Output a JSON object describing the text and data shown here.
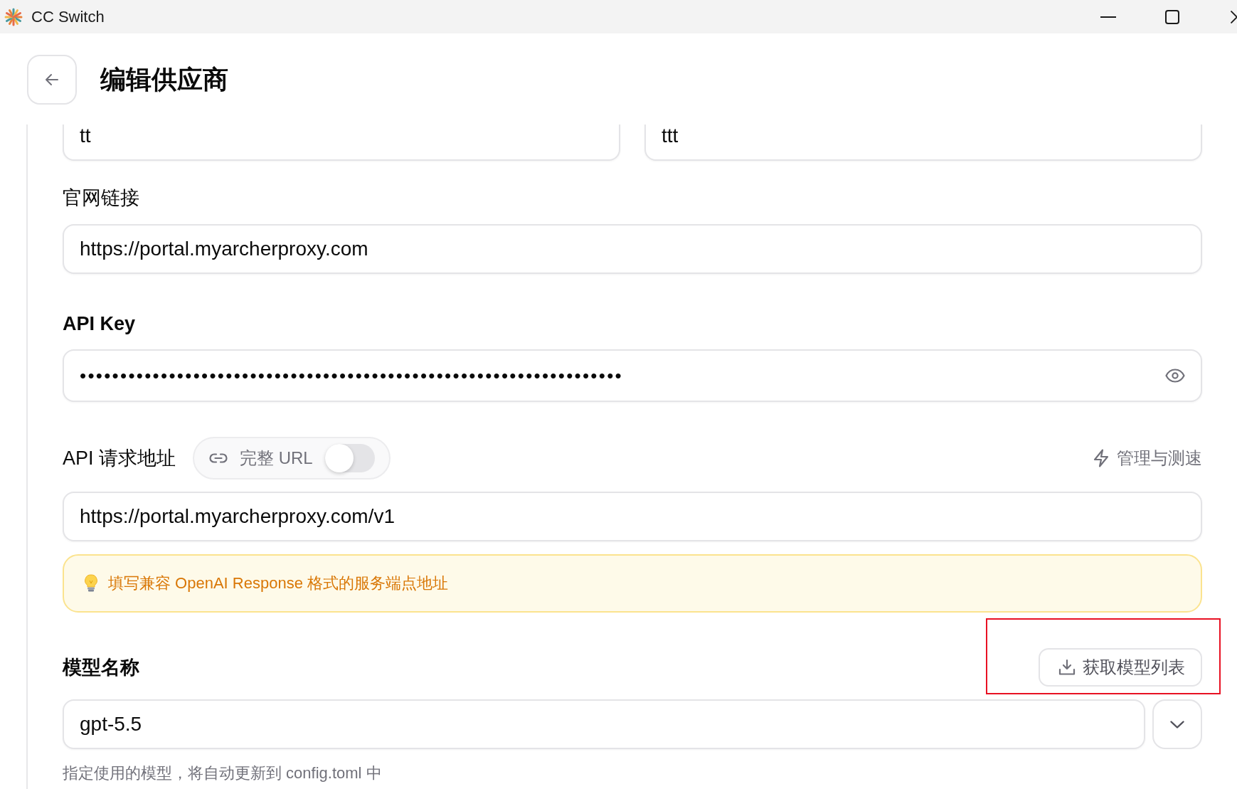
{
  "window": {
    "title": "CC Switch"
  },
  "header": {
    "title": "编辑供应商"
  },
  "top_fields": [
    {
      "value": "tt"
    },
    {
      "value": "ttt"
    }
  ],
  "website": {
    "label": "官网链接",
    "emphasis": false,
    "value": "https://portal.myarcherproxy.com"
  },
  "api_key": {
    "label": "API Key",
    "emphasis": true,
    "value": "•••••••••••••••••••••••••••••••••••••••••••••••••••••••••••••••••••"
  },
  "endpoint": {
    "label": "API 请求地址",
    "emphasis": false,
    "full_url_toggle": {
      "label": "完整 URL",
      "on": false
    },
    "manage_link": "管理与测速",
    "value": "https://portal.myarcherproxy.com/v1",
    "hint": "填写兼容 OpenAI Response 格式的服务端点地址"
  },
  "model": {
    "label": "模型名称",
    "emphasis": true,
    "fetch_button": {
      "label": "获取模型列表",
      "highlighted": true
    },
    "value": "gpt-5.5",
    "helper": "指定使用的模型，将自动更新到 config.toml 中"
  }
}
